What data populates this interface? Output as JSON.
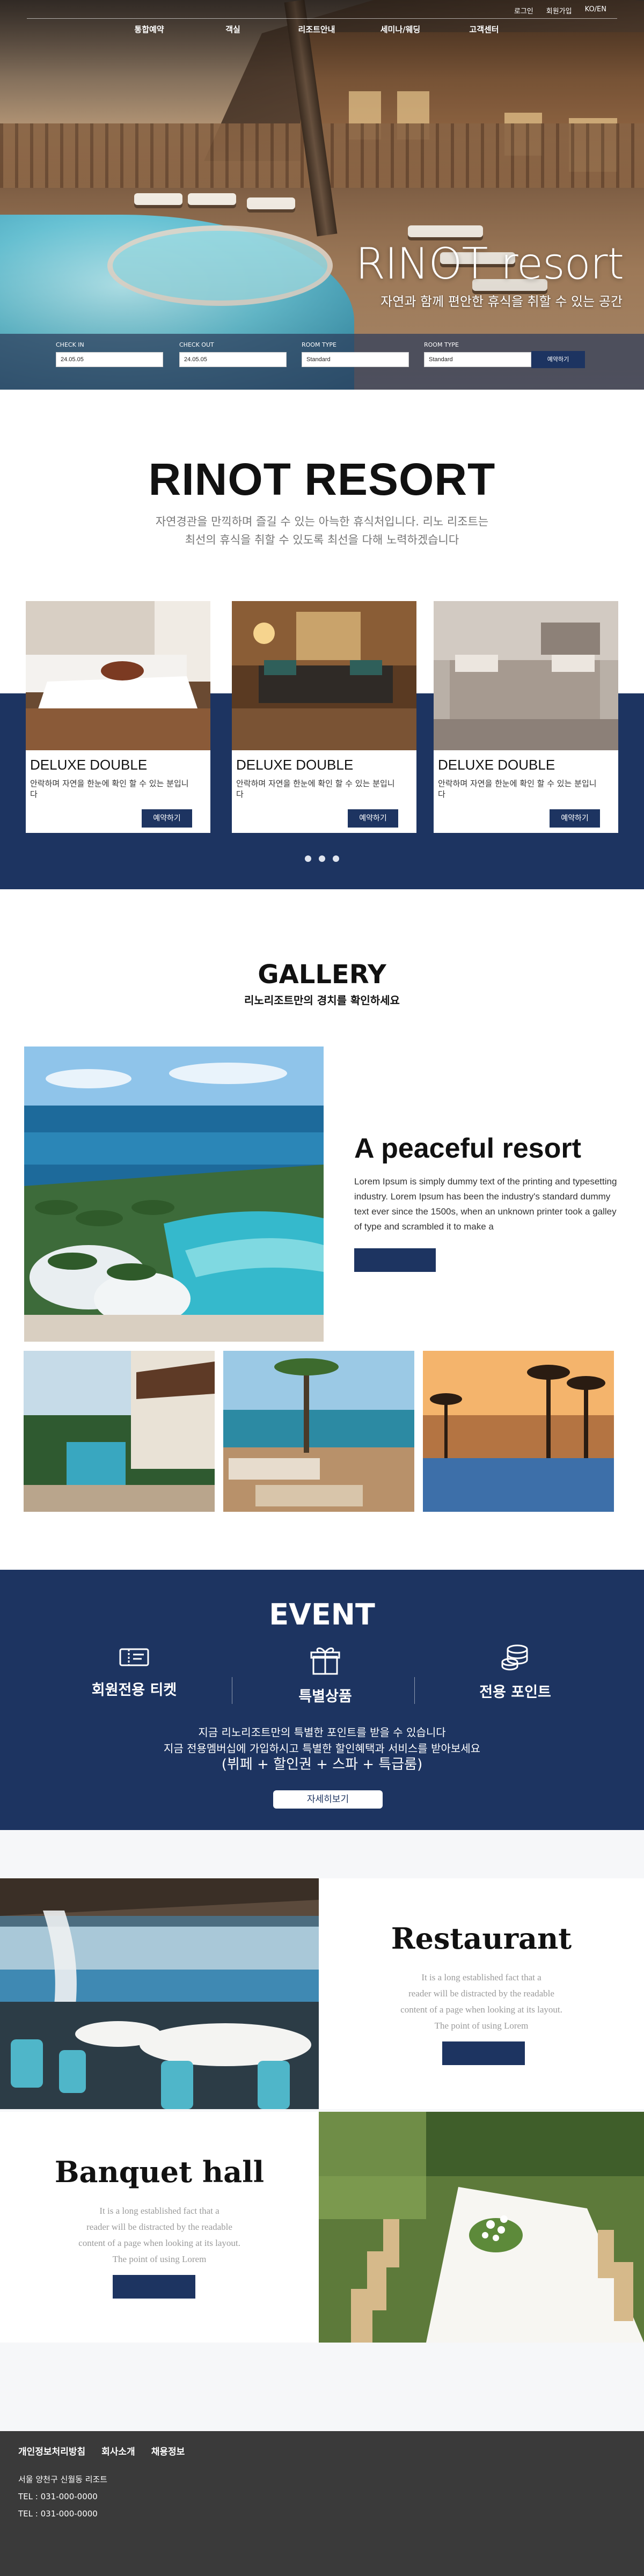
{
  "topbar": {
    "login": "로그인",
    "signup": "회원가입",
    "language": "KO/EN"
  },
  "nav": [
    "통합예약",
    "객실",
    "리조트안내",
    "세미나/웨딩",
    "고객센터"
  ],
  "hero": {
    "title": "RINOT resort",
    "subtitle": "자연과 함께 편안한 휴식을 취할 수 있는 공간"
  },
  "booking": {
    "fields": [
      {
        "label": "CHECK IN",
        "value": "24.05.05"
      },
      {
        "label": "CHECK OUT",
        "value": "24.05.05"
      },
      {
        "label": "ROOM TYPE",
        "value": "Standard"
      },
      {
        "label": "ROOM TYPE",
        "value": "Standard"
      }
    ],
    "button": "예약하기"
  },
  "about": {
    "title": "RINOT RESORT",
    "desc1": "자연경관을 만끽하며 즐길 수 있는 아늑한 휴식처입니다. 리노 리조트는",
    "desc2": "최선의 휴식을 취할 수 있도록 최선을 다해 노력하겠습니다"
  },
  "rooms": [
    {
      "name": "DELUXE DOUBLE",
      "desc": "안락하며 자연을 한눈에 확인 할 수 있는 분입니다",
      "button": "예약하기"
    },
    {
      "name": "DELUXE DOUBLE",
      "desc": "안락하며 자연을 한눈에 확인 할 수 있는 분입니다",
      "button": "예약하기"
    },
    {
      "name": "DELUXE DOUBLE",
      "desc": "안락하며 자연을 한눈에 확인 할 수 있는 분입니다",
      "button": "예약하기"
    }
  ],
  "gallery": {
    "title": "GALLERY",
    "subtitle": "리노리조트만의 경치를 확인하세요",
    "feature_title": "A peaceful resort",
    "feature_text": "Lorem Ipsum is simply dummy text of the printing and typesetting industry. Lorem Ipsum has been the industry's standard dummy text ever since the 1500s, when an unknown printer took a galley of type and scrambled it to make a"
  },
  "event": {
    "title": "EVENT",
    "items": [
      {
        "label": "회원전용 티켓",
        "icon": "ticket-icon"
      },
      {
        "label": "특별상품",
        "icon": "gift-icon"
      },
      {
        "label": "전용 포인트",
        "icon": "coins-icon"
      }
    ],
    "desc1": "지금 리노리조트만의 특별한 포인트를 받을 수 있습니다",
    "desc2": "지금 전용멤버십에 가입하시고 특별한 할인혜택과 서비스를 받아보세요",
    "desc3": "(뷔페 + 할인권 + 스파 + 특급룸)",
    "button": "자세히보기"
  },
  "restaurant": {
    "title": "Restaurant",
    "lines": [
      "It is a long established fact that a",
      "reader will be distracted by the readable",
      "content of a page when looking at its layout.",
      "The point of using Lorem"
    ]
  },
  "banquet": {
    "title": "Banquet hall",
    "lines": [
      "It is a long established fact that a",
      "reader will be distracted by the readable",
      "content of a page when looking at its layout.",
      "The point of using Lorem"
    ]
  },
  "footer": {
    "links": [
      "개인정보처리방침",
      "회사소개",
      "채용정보"
    ],
    "address": "서울 양천구 신월동 리조트",
    "tel1": "TEL : 031-000-0000",
    "tel2": "TEL : 031-000-0000"
  },
  "colors": {
    "primary": "#1d3461",
    "footer": "#3a3a3a",
    "soft_bg": "#f6f7f9"
  }
}
